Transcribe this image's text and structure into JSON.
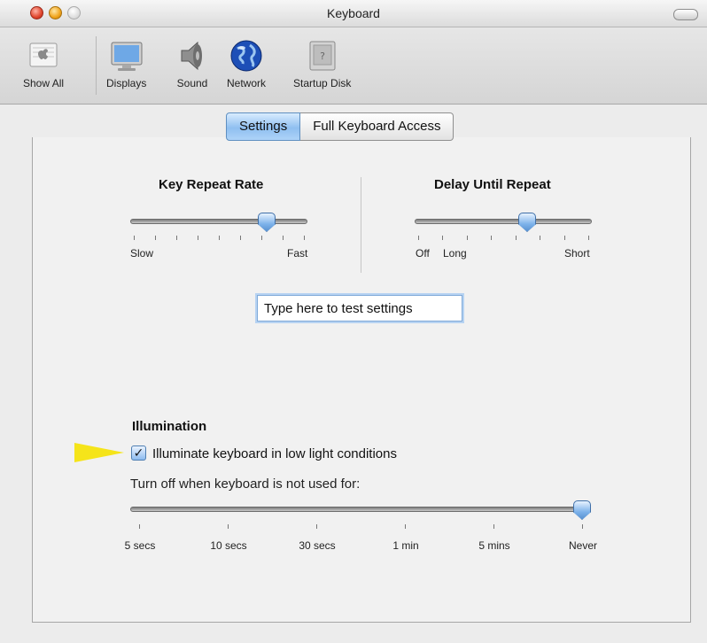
{
  "window": {
    "title": "Keyboard"
  },
  "toolbar": {
    "items": [
      {
        "label": "Show All",
        "icon": "apple-logo-icon"
      },
      {
        "label": "Displays",
        "icon": "display-icon"
      },
      {
        "label": "Sound",
        "icon": "speaker-icon"
      },
      {
        "label": "Network",
        "icon": "globe-icon"
      },
      {
        "label": "Startup Disk",
        "icon": "startup-disk-icon"
      }
    ]
  },
  "tabs": [
    {
      "label": "Settings",
      "selected": true
    },
    {
      "label": "Full Keyboard Access",
      "selected": false
    }
  ],
  "key_repeat": {
    "title": "Key Repeat Rate",
    "min_label": "Slow",
    "max_label": "Fast",
    "value_fraction": 0.8
  },
  "delay_until_repeat": {
    "title": "Delay Until Repeat",
    "labels": [
      "Off",
      "Long",
      "Short"
    ],
    "value_fraction": 0.65
  },
  "test_field": {
    "placeholder": "Type here to test settings"
  },
  "illumination": {
    "title": "Illumination",
    "checkbox_label": "Illuminate keyboard in low light conditions",
    "checked": true,
    "turnoff_label": "Turn off when keyboard is not used for:",
    "slider_options": [
      "5 secs",
      "10 secs",
      "30 secs",
      "1 min",
      "5 mins",
      "Never"
    ],
    "selected_option": "Never"
  },
  "colors": {
    "accent": "#7db2ea",
    "highlight_arrow": "#f5e41a"
  }
}
